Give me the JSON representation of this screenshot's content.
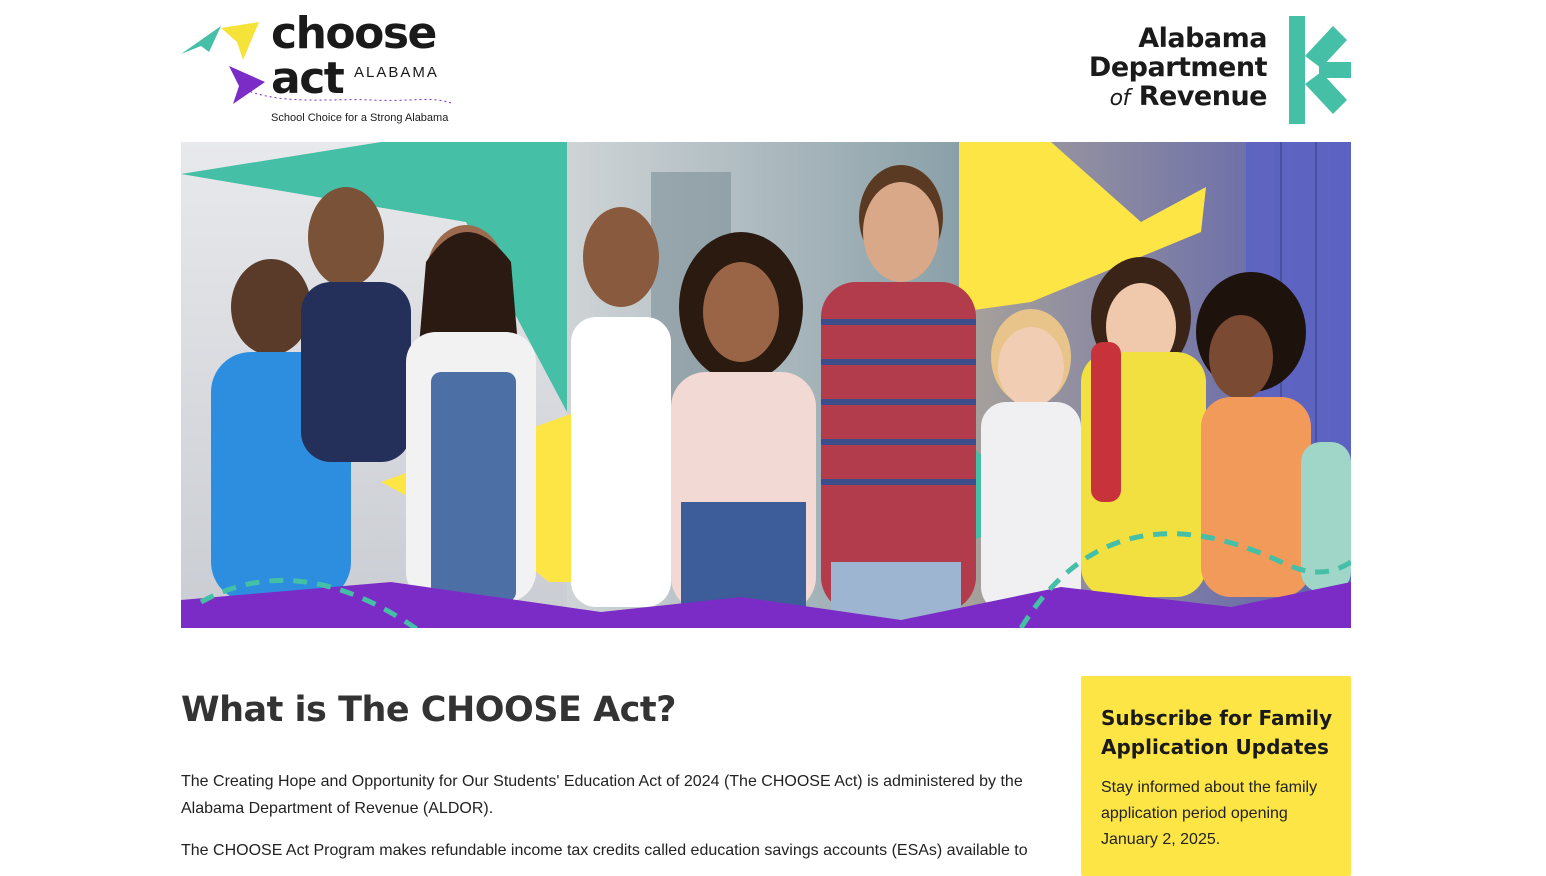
{
  "header": {
    "choose_logo": {
      "word1": "choose",
      "word2": "act",
      "state": "ALABAMA",
      "tagline": "School Choice for a Strong Alabama"
    },
    "dor_logo": {
      "line1": "Alabama",
      "line2": "Department",
      "of": "of",
      "line3": "Revenue"
    }
  },
  "hero": {
    "icon": "hero-students-photo"
  },
  "main": {
    "title": "What is The CHOOSE Act?",
    "paragraphs": [
      "The Creating Hope and Opportunity for Our Students' Education Act of 2024 (The CHOOSE Act) is administered by the Alabama Department of Revenue (ALDOR).",
      "The CHOOSE Act Program makes refundable income tax credits called education savings accounts (ESAs) available to"
    ]
  },
  "subscribe": {
    "title": "Subscribe for Family Application Updates",
    "body": "Stay informed about the family application period opening January 2, 2025."
  },
  "colors": {
    "teal": "#45bfa5",
    "yellow": "#fde545",
    "purple": "#7b2cc6",
    "text": "#333333"
  }
}
